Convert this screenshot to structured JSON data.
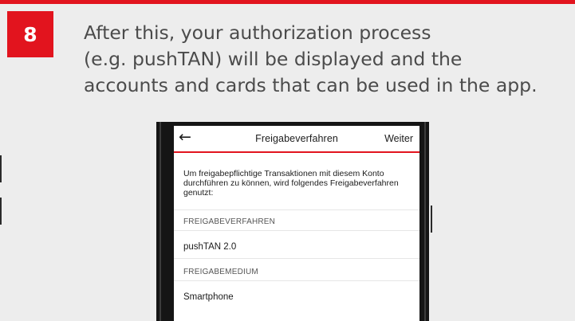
{
  "step": {
    "number": "8",
    "instruction_lines": [
      "After this, your authorization process",
      "(e.g. pushTAN) will be displayed and the",
      "accounts and cards that can be used in the app."
    ]
  },
  "colors": {
    "accent": "#e2141e",
    "background": "#ededed",
    "text": "#4b4b4b"
  },
  "screen": {
    "nav": {
      "back_icon": "←",
      "title": "Freigabeverfahren",
      "next_label": "Weiter"
    },
    "description": "Um freigabepflichtige Transaktionen mit diesem Konto durchführen zu können, wird folgendes Freigabeverfahren genutzt:",
    "sections": [
      {
        "label": "FREIGABEVERFAHREN",
        "value": "pushTAN 2.0"
      },
      {
        "label": "FREIGABEMEDIUM",
        "value": "Smartphone"
      }
    ]
  }
}
